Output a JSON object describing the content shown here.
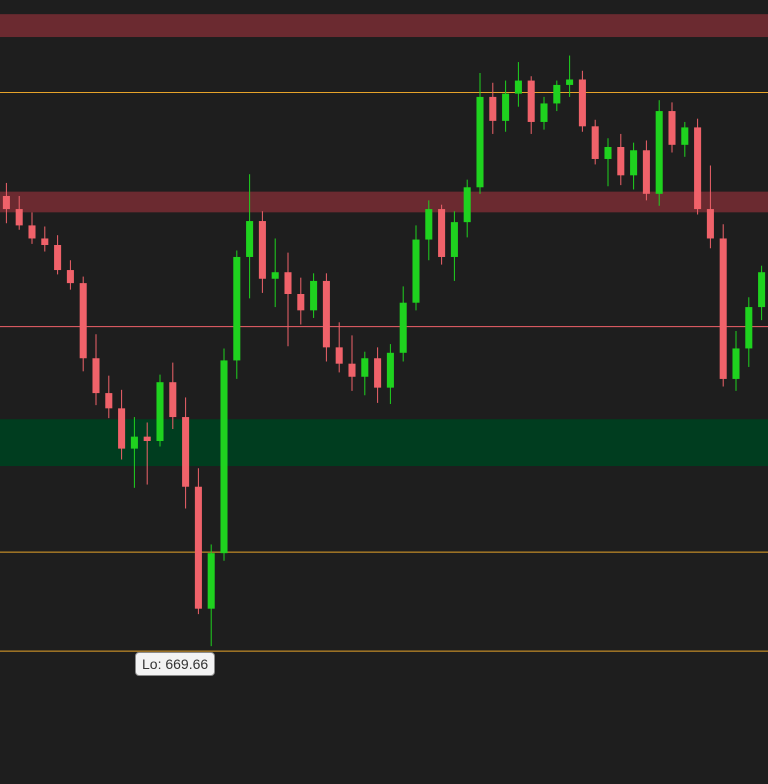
{
  "chart_data": {
    "type": "candlestick",
    "low_label": "Lo: 669.66",
    "ylim": [
      657,
      729
    ],
    "colors": {
      "background": "#1e1e1e",
      "up": "#1fd21f",
      "down": "#f0626a",
      "resistance_zone": "#6b2a30",
      "support_zone": "#003d1f",
      "orange": "#e6a32a",
      "cyan": "#3cc6d8"
    },
    "zones": [
      {
        "kind": "resistance",
        "from": 727.7,
        "to": 725.6
      },
      {
        "kind": "resistance",
        "from": 711.4,
        "to": 709.5
      },
      {
        "kind": "support",
        "from": 690.5,
        "to": 686.2
      }
    ],
    "levels": [
      {
        "kind": "orange",
        "price": 720.5
      },
      {
        "kind": "red",
        "price": 699.0
      },
      {
        "kind": "orange",
        "price": 678.3
      },
      {
        "kind": "orange",
        "price": 669.2
      }
    ],
    "series": [
      [
        711,
        712.2,
        708.5,
        709.8
      ],
      [
        709.8,
        711,
        707.9,
        708.3
      ],
      [
        708.3,
        709.5,
        706.6,
        707.1
      ],
      [
        707.1,
        708.2,
        705.9,
        706.5
      ],
      [
        706.5,
        707.4,
        703.8,
        704.2
      ],
      [
        704.2,
        705.1,
        702.4,
        703.0
      ],
      [
        703.0,
        703.6,
        694.9,
        696.1
      ],
      [
        696.1,
        698.3,
        691.8,
        692.9
      ],
      [
        692.9,
        694.5,
        690.6,
        691.5
      ],
      [
        691.5,
        693.2,
        686.8,
        687.8
      ],
      [
        687.8,
        690.7,
        684.2,
        688.9
      ],
      [
        688.9,
        690.2,
        684.5,
        688.5
      ],
      [
        688.5,
        694.6,
        688.0,
        693.9
      ],
      [
        693.9,
        695.7,
        689.6,
        690.7
      ],
      [
        690.7,
        692.5,
        682.3,
        684.3
      ],
      [
        684.3,
        686.0,
        672.6,
        673.1
      ],
      [
        673.1,
        679.0,
        669.66,
        678.2
      ],
      [
        678.2,
        697.0,
        677.5,
        695.9
      ],
      [
        695.9,
        706.0,
        694.2,
        705.4
      ],
      [
        705.4,
        713.0,
        701.6,
        708.7
      ],
      [
        708.7,
        709.6,
        702.1,
        703.4
      ],
      [
        703.4,
        707.1,
        700.8,
        704.0
      ],
      [
        704.0,
        705.8,
        697.2,
        702.0
      ],
      [
        702.0,
        703.5,
        699.2,
        700.5
      ],
      [
        700.5,
        703.9,
        699.8,
        703.2
      ],
      [
        703.2,
        703.9,
        695.8,
        697.1
      ],
      [
        697.1,
        699.4,
        694.8,
        695.6
      ],
      [
        695.6,
        698.2,
        693.1,
        694.4
      ],
      [
        694.4,
        696.7,
        692.7,
        696.1
      ],
      [
        696.1,
        697.1,
        692.0,
        693.4
      ],
      [
        693.4,
        697.4,
        691.9,
        696.6
      ],
      [
        696.6,
        702.7,
        695.8,
        701.2
      ],
      [
        701.2,
        708.3,
        700.5,
        707.0
      ],
      [
        707.0,
        710.6,
        705.1,
        709.8
      ],
      [
        709.8,
        710.2,
        704.7,
        705.4
      ],
      [
        705.4,
        709.6,
        703.2,
        708.6
      ],
      [
        708.6,
        712.5,
        707.2,
        711.8
      ],
      [
        711.8,
        722.3,
        711.2,
        720.1
      ],
      [
        720.1,
        721.4,
        716.7,
        717.9
      ],
      [
        717.9,
        721.6,
        716.9,
        720.4
      ],
      [
        720.4,
        723.3,
        719.2,
        721.6
      ],
      [
        721.6,
        722.0,
        716.7,
        717.8
      ],
      [
        717.8,
        720.1,
        717.1,
        719.5
      ],
      [
        719.5,
        721.6,
        718.8,
        721.2
      ],
      [
        721.2,
        723.9,
        720.1,
        721.7
      ],
      [
        721.7,
        722.5,
        716.9,
        717.4
      ],
      [
        717.4,
        718.0,
        713.9,
        714.4
      ],
      [
        714.4,
        716.3,
        711.9,
        715.5
      ],
      [
        715.5,
        716.7,
        712.0,
        712.9
      ],
      [
        712.9,
        715.9,
        711.6,
        715.2
      ],
      [
        715.2,
        716.1,
        710.6,
        711.2
      ],
      [
        711.2,
        719.8,
        710.1,
        718.8
      ],
      [
        718.8,
        719.6,
        715.0,
        715.7
      ],
      [
        715.7,
        717.8,
        714.6,
        717.3
      ],
      [
        717.3,
        718.1,
        709.3,
        709.8
      ],
      [
        709.8,
        713.8,
        706.2,
        707.1
      ],
      [
        707.1,
        708.4,
        693.5,
        694.2
      ],
      [
        694.2,
        698.6,
        693.1,
        697.0
      ],
      [
        697.0,
        701.7,
        695.3,
        700.8
      ],
      [
        700.8,
        704.6,
        699.6,
        704.0
      ]
    ]
  }
}
